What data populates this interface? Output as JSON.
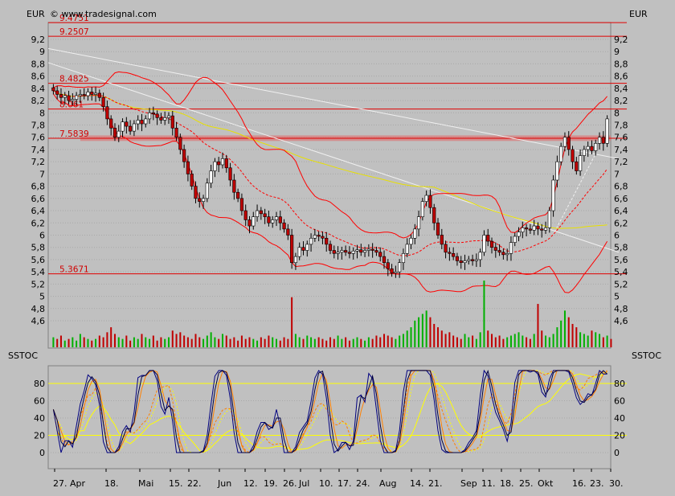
{
  "header": {
    "currency_left": "EUR",
    "currency_right": "EUR",
    "watermark": "© www.tradesignal.com"
  },
  "chart_data": [
    {
      "type": "candlestick",
      "panel": "price",
      "yticks": [
        "9,2",
        "9",
        "8,8",
        "8,6",
        "8,4",
        "8,2",
        "8",
        "7,8",
        "7,6",
        "7,4",
        "7,2",
        "7",
        "6,8",
        "6,6",
        "6,4",
        "6,2",
        "6",
        "5,8",
        "5,6",
        "5,4",
        "5,2",
        "5",
        "4,8",
        "4,6"
      ],
      "ylim": [
        4.45,
        9.45
      ],
      "levels": [
        {
          "label": "9.4751",
          "value": 9.4751
        },
        {
          "label": "9.2507",
          "value": 9.2507
        },
        {
          "label": "8.4825",
          "value": 8.4825
        },
        {
          "label": "8.061",
          "value": 8.061
        },
        {
          "label": "7.5839",
          "value": 7.5839
        },
        {
          "label": "5.3671",
          "value": 5.3671
        }
      ],
      "close": [
        8.36,
        8.3,
        8.25,
        8.28,
        8.2,
        8.22,
        8.28,
        8.3,
        8.28,
        8.34,
        8.3,
        8.32,
        8.25,
        8.1,
        7.9,
        7.75,
        7.6,
        7.7,
        7.85,
        7.78,
        7.7,
        7.82,
        7.88,
        7.82,
        7.9,
        8.0,
        7.98,
        7.92,
        7.88,
        7.92,
        7.95,
        7.75,
        7.6,
        7.4,
        7.2,
        7.0,
        6.8,
        6.6,
        6.55,
        6.6,
        6.85,
        7.05,
        7.2,
        7.15,
        7.25,
        7.1,
        6.9,
        6.7,
        6.6,
        6.4,
        6.25,
        6.15,
        6.3,
        6.4,
        6.35,
        6.3,
        6.2,
        6.25,
        6.3,
        6.2,
        6.1,
        6.0,
        5.55,
        5.65,
        5.8,
        5.75,
        5.85,
        5.95,
        6.0,
        5.98,
        5.95,
        5.85,
        5.75,
        5.7,
        5.72,
        5.75,
        5.72,
        5.7,
        5.74,
        5.76,
        5.72,
        5.75,
        5.77,
        5.75,
        5.72,
        5.65,
        5.55,
        5.45,
        5.38,
        5.4,
        5.55,
        5.7,
        5.85,
        5.95,
        6.1,
        6.3,
        6.55,
        6.65,
        6.45,
        6.2,
        6.0,
        5.85,
        5.72,
        5.7,
        5.65,
        5.58,
        5.55,
        5.58,
        5.6,
        5.58,
        5.6,
        5.72,
        6.0,
        5.9,
        5.8,
        5.75,
        5.72,
        5.68,
        5.7,
        5.88,
        5.98,
        6.05,
        6.12,
        6.1,
        6.08,
        6.15,
        6.1,
        6.08,
        6.12,
        6.4,
        6.9,
        7.2,
        7.45,
        7.6,
        7.4,
        7.2,
        7.05,
        7.3,
        7.4,
        7.45,
        7.38,
        7.5,
        7.6,
        7.5,
        7.9
      ],
      "volume": [
        6,
        5,
        7,
        4,
        5,
        6,
        4,
        8,
        6,
        5,
        4,
        5,
        7,
        6,
        9,
        12,
        8,
        6,
        5,
        7,
        4,
        6,
        5,
        8,
        6,
        5,
        7,
        4,
        6,
        5,
        6,
        10,
        8,
        9,
        7,
        6,
        5,
        8,
        6,
        5,
        7,
        9,
        6,
        5,
        8,
        7,
        5,
        6,
        4,
        7,
        5,
        6,
        5,
        4,
        6,
        5,
        7,
        6,
        5,
        4,
        6,
        5,
        30,
        8,
        6,
        5,
        7,
        6,
        5,
        6,
        5,
        4,
        6,
        5,
        7,
        5,
        6,
        4,
        5,
        6,
        5,
        4,
        6,
        5,
        7,
        6,
        8,
        7,
        6,
        5,
        7,
        8,
        10,
        12,
        16,
        18,
        20,
        22,
        18,
        14,
        12,
        10,
        8,
        9,
        7,
        6,
        5,
        8,
        6,
        7,
        5,
        9,
        40,
        10,
        8,
        6,
        7,
        5,
        6,
        7,
        8,
        9,
        7,
        6,
        5,
        8,
        26,
        10,
        7,
        6,
        8,
        12,
        16,
        22,
        18,
        14,
        12,
        9,
        8,
        7,
        10,
        9,
        8,
        6,
        7,
        5
      ]
    },
    {
      "type": "line",
      "panel": "oscillator",
      "title": "SSTOC",
      "yticks": [
        "80",
        "60",
        "40",
        "20",
        "0"
      ],
      "ylim": [
        -8,
        98
      ],
      "levels": [
        80,
        20
      ],
      "xticks": [
        "27. Apr",
        "18.",
        "Mai",
        "15.",
        "22.",
        "Jun",
        "12.",
        "19.",
        "26.",
        "Jul",
        "10.",
        "17.",
        "24.",
        "Aug",
        "14.",
        "21.",
        "Sep",
        "11.",
        "18.",
        "25.",
        "Okt",
        "16.",
        "23.",
        "30."
      ]
    }
  ],
  "colors": {
    "background": "#c0c0c0",
    "grid": "#a8a8a8",
    "level_line": "#e00000",
    "band_fill": "#d88080",
    "up_candle": "#00b000",
    "down_candle": "#c00000",
    "bollinger": "#ff0000",
    "trend_line": "#f0f0f0",
    "moving_avg": "#e8e000",
    "stoch_fast": "#000080",
    "stoch_slow": "#ff8000",
    "stoch_long": "#ffff00",
    "stoch_level": "#ffff00"
  }
}
